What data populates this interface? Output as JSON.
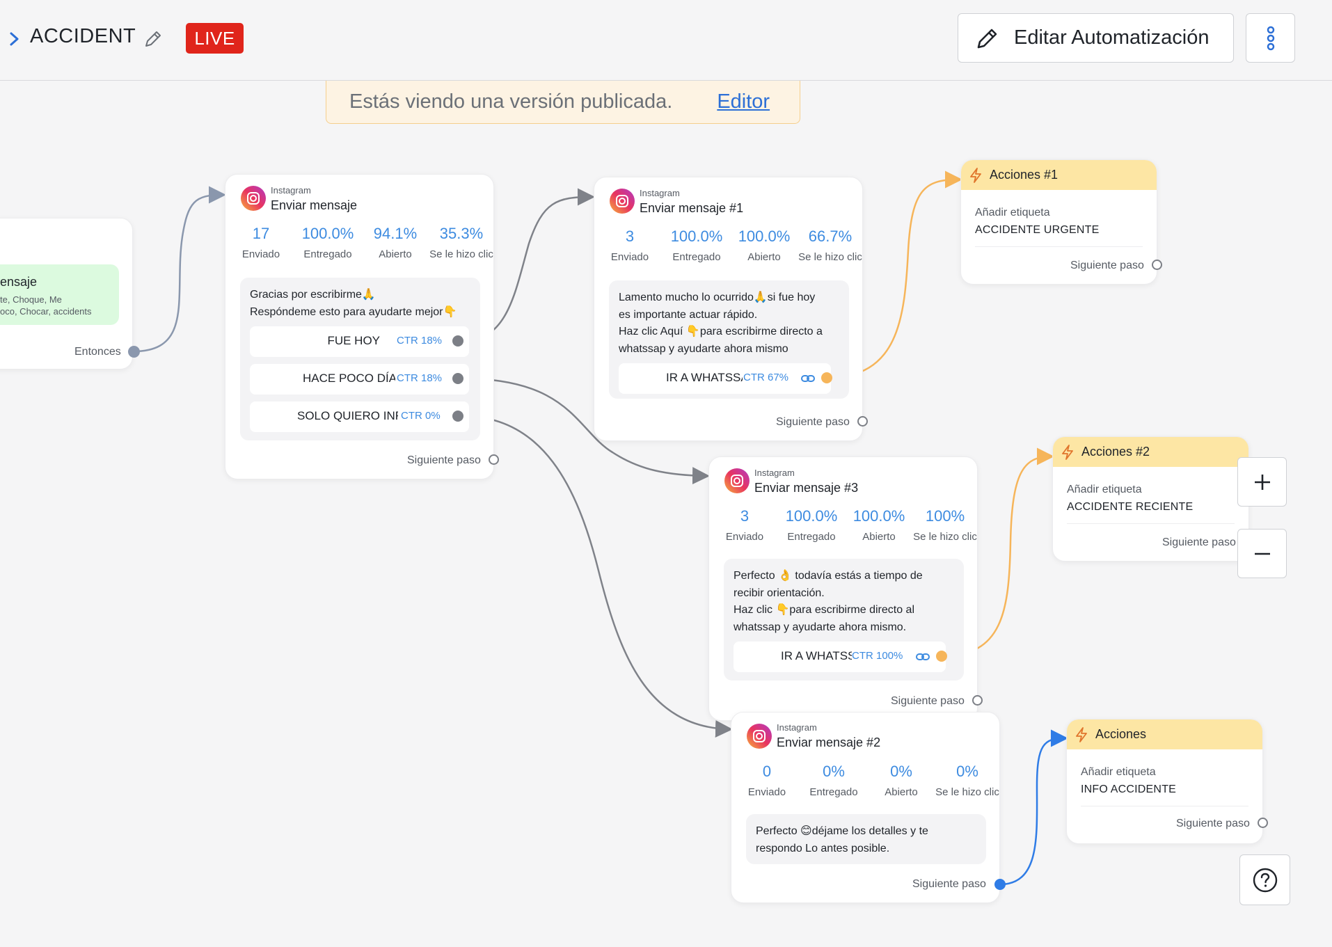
{
  "header": {
    "title": "ACCIDENT",
    "live_label": "LIVE",
    "edit_button": "Editar Automatización"
  },
  "banner": {
    "text": "Estás viendo una versión publicada.",
    "link": "Editor"
  },
  "colors": {
    "accent_blue": "#3d8be0",
    "live_red": "#e0251b",
    "action_header": "#fde6a4",
    "trigger_green": "#dcfadf"
  },
  "trigger": {
    "title_partial": "ensaje",
    "keywords_line1": "te, Choque, Me",
    "keywords_line2": "oco, Chocar, accidents",
    "next_label": "Entonces"
  },
  "nodes": {
    "msg_main": {
      "platform": "Instagram",
      "title": "Enviar mensaje",
      "stats": [
        {
          "value": "17",
          "label": "Enviado"
        },
        {
          "value": "100.0%",
          "label": "Entregado"
        },
        {
          "value": "94.1%",
          "label": "Abierto"
        },
        {
          "value": "35.3%",
          "label": "Se le hizo clic"
        }
      ],
      "message_line1": "Gracias por escribirme🙏",
      "message_line2": "Respóndeme esto para ayudarte mejor👇",
      "buttons": [
        {
          "label": "FUE HOY",
          "ctr": "CTR 18%"
        },
        {
          "label": "HACE POCO DÍAS",
          "ctr": "CTR 18%"
        },
        {
          "label": "SOLO QUIERO INFO",
          "ctr": "CTR 0%"
        }
      ],
      "next_label": "Siguiente paso"
    },
    "msg_1": {
      "platform": "Instagram",
      "title": "Enviar mensaje #1",
      "stats": [
        {
          "value": "3",
          "label": "Enviado"
        },
        {
          "value": "100.0%",
          "label": "Entregado"
        },
        {
          "value": "100.0%",
          "label": "Abierto"
        },
        {
          "value": "66.7%",
          "label": "Se le hizo clic"
        }
      ],
      "message_lines": [
        "Lamento mucho lo ocurrido🙏si fue hoy",
        "es importante actuar rápido.",
        "Haz clic Aquí 👇para escribirme directo a",
        "whatssap y ayudarte ahora mismo"
      ],
      "button": {
        "label": "IR A WHATSSAP",
        "ctr": "CTR 67%"
      },
      "next_label": "Siguiente paso"
    },
    "msg_3": {
      "platform": "Instagram",
      "title": "Enviar mensaje #3",
      "stats": [
        {
          "value": "3",
          "label": "Enviado"
        },
        {
          "value": "100.0%",
          "label": "Entregado"
        },
        {
          "value": "100.0%",
          "label": "Abierto"
        },
        {
          "value": "100%",
          "label": "Se le hizo clic"
        }
      ],
      "message_lines": [
        "Perfecto 👌 todavía estás a tiempo de",
        "recibir orientación.",
        "Haz clic 👇para escribirme directo al",
        "whatssap y ayudarte ahora mismo."
      ],
      "button": {
        "label": "IR A WHATSSAP",
        "ctr": "CTR 100%"
      },
      "next_label": "Siguiente paso"
    },
    "msg_2": {
      "platform": "Instagram",
      "title": "Enviar mensaje #2",
      "stats": [
        {
          "value": "0",
          "label": "Enviado"
        },
        {
          "value": "0%",
          "label": "Entregado"
        },
        {
          "value": "0%",
          "label": "Abierto"
        },
        {
          "value": "0%",
          "label": "Se le hizo clic"
        }
      ],
      "message_lines": [
        "Perfecto 😊déjame los detalles y te",
        "respondo Lo antes posible."
      ],
      "next_label": "Siguiente paso"
    }
  },
  "actions": {
    "a1": {
      "title": "Acciones #1",
      "label": "Añadir etiqueta",
      "value": "ACCIDENTE URGENTE",
      "next_label": "Siguiente paso"
    },
    "a2": {
      "title": "Acciones #2",
      "label": "Añadir etiqueta",
      "value": "ACCIDENTE RECIENTE",
      "next_label": "Siguiente paso"
    },
    "a3": {
      "title": "Acciones",
      "label": "Añadir etiqueta",
      "value": "INFO ACCIDENTE",
      "next_label": "Siguiente paso"
    }
  },
  "icons": {
    "back": "chevron-right-icon",
    "rename": "pencil-icon",
    "edit": "pencil-icon",
    "more": "kebab-vertical-icon",
    "platform": "instagram-icon",
    "action": "lightning-bolt-icon",
    "url": "link-icon",
    "zoom_in": "plus-icon",
    "zoom_out": "minus-icon",
    "help": "question-mark-icon"
  }
}
